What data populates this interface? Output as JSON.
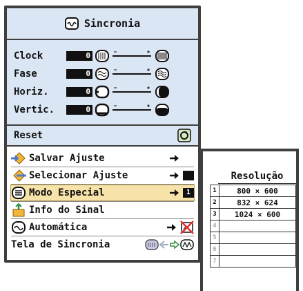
{
  "menu": {
    "title": "Sincronia",
    "adjustments": [
      {
        "label": "Clock",
        "value": "0",
        "icon": "clock-wave-icon"
      },
      {
        "label": "Fase",
        "value": "0",
        "icon": "phase-wave-icon"
      },
      {
        "label": "Horiz.",
        "value": "0",
        "icon": "horizontal-shift-icon"
      },
      {
        "label": "Vertic.",
        "value": "0",
        "icon": "vertical-shift-icon"
      }
    ],
    "reset": {
      "label": "Reset",
      "icon": "reset-icon"
    },
    "options": [
      {
        "label": "Salvar Ajuste",
        "icon": "save-diamond-icon",
        "end": "arrow"
      },
      {
        "label": "Selecionar Ajuste",
        "icon": "select-diamond-icon",
        "end": "arrow-box"
      },
      {
        "label": "Modo Especial",
        "icon": "special-mode-icon",
        "end": "arrow-box-1",
        "end_text": "1",
        "selected": true
      },
      {
        "label": "Info do Sinal",
        "icon": "signal-info-icon",
        "end": ""
      },
      {
        "label": "Automática",
        "icon": "auto-sync-icon",
        "end": "arrow-crossed"
      },
      {
        "label": "Tela de Sincronia",
        "icon": "sync-screen-icon",
        "end": "arrows-icons"
      }
    ]
  },
  "resolution_panel": {
    "header": "Resolução",
    "rows": [
      {
        "num": "1",
        "value": "800 × 600"
      },
      {
        "num": "2",
        "value": "832 × 624"
      },
      {
        "num": "3",
        "value": "1024 × 600"
      },
      {
        "num": "4",
        "value": ""
      },
      {
        "num": "5",
        "value": ""
      },
      {
        "num": "6",
        "value": ""
      },
      {
        "num": "7",
        "value": ""
      }
    ]
  }
}
